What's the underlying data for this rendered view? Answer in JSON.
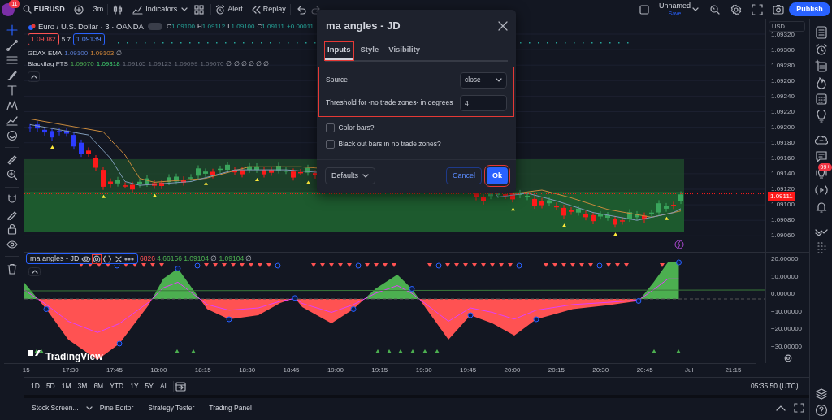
{
  "top_bar": {
    "notification_count": "11",
    "symbol": "EURUSD",
    "interval": "3m",
    "indicators": "Indicators",
    "alert": "Alert",
    "replay": "Replay",
    "layout_name": "Unnamed",
    "save": "Save",
    "publish": "Publish"
  },
  "chart": {
    "title": "Euro / U.S. Dollar · 3 · OANDA",
    "ohlc": [
      {
        "label": "O",
        "value": "1.09100"
      },
      {
        "label": "H",
        "value": "1.09112"
      },
      {
        "label": "L",
        "value": "1.09100"
      },
      {
        "label": "C",
        "value": "1.09111"
      }
    ],
    "change": "+0.00011",
    "sell": "1.09082",
    "spread": "5.7",
    "buy": "1.09139",
    "studies": [
      {
        "name": "GDAX EMA",
        "values": [
          {
            "text": "1.09100",
            "kind": "blue"
          },
          {
            "text": "1.09103",
            "kind": "orange"
          },
          {
            "text": "∅",
            "kind": "empty"
          }
        ]
      },
      {
        "name": "Blackflag FTS",
        "values": [
          {
            "text": "1.09070",
            "kind": "green"
          },
          {
            "text": "1.09318",
            "kind": "bright"
          },
          {
            "text": "1.09165",
            "kind": "faded"
          },
          {
            "text": "1.09123",
            "kind": "faded"
          },
          {
            "text": "1.09099",
            "kind": "faded"
          },
          {
            "text": "1.09070",
            "kind": "faded"
          },
          {
            "text": "∅ ∅ ∅ ∅ ∅ ∅",
            "kind": "empty"
          }
        ]
      }
    ],
    "logo_text": "TradingView"
  },
  "price_axis": {
    "currency": "USD",
    "labels": [
      "1.09320",
      "1.09300",
      "1.09280",
      "1.09260",
      "1.09240",
      "1.09220",
      "1.09200",
      "1.09180",
      "1.09160",
      "1.09140",
      "1.09120",
      "1.09100",
      "1.09080",
      "1.09060"
    ],
    "last_price": "1.09111"
  },
  "oscillator": {
    "name": "ma angles - JD",
    "settings_highlighted": true,
    "values": [
      {
        "text": "6826",
        "kind": "red"
      },
      {
        "text": "4.66156",
        "kind": "green"
      },
      {
        "text": "1.09104",
        "kind": "green"
      },
      {
        "text": "∅",
        "kind": "empty"
      },
      {
        "text": "1.09104",
        "kind": "green"
      },
      {
        "text": "∅",
        "kind": "empty"
      }
    ],
    "axis_labels": [
      "20.00000",
      "10.00000",
      "0.00000",
      "−10.00000",
      "−20.00000",
      "−30.00000"
    ]
  },
  "time_axis": [
    "15",
    "17:30",
    "17:45",
    "18:00",
    "18:15",
    "18:30",
    "18:45",
    "19:00",
    "19:15",
    "19:30",
    "19:45",
    "20:00",
    "20:15",
    "20:30",
    "20:45",
    "Jul",
    "21:15"
  ],
  "ranges": [
    "1D",
    "5D",
    "1M",
    "3M",
    "6M",
    "YTD",
    "1Y",
    "5Y",
    "All"
  ],
  "clock": "05:35:50 (UTC)",
  "bottom_tabs": [
    "Stock Screen...",
    "Pine Editor",
    "Strategy Tester",
    "Trading Panel"
  ],
  "alerts_badge": "99+",
  "dialog": {
    "title": "ma angles - JD",
    "tabs": [
      {
        "label": "Inputs",
        "selected": true,
        "highlighted": true
      },
      {
        "label": "Style",
        "selected": false,
        "highlighted": false
      },
      {
        "label": "Visibility",
        "selected": false,
        "highlighted": false
      }
    ],
    "inputs_highlighted": true,
    "fields": [
      {
        "kind": "select",
        "label": "Source",
        "value": "close"
      },
      {
        "kind": "number",
        "label": "Threshold for -no trade zones- in degrees",
        "value": "4"
      }
    ],
    "checkboxes": [
      {
        "label": "Color bars?",
        "checked": false
      },
      {
        "label": "Black out bars in no trade zones?",
        "checked": false
      }
    ],
    "defaults": "Defaults",
    "buttons": [
      {
        "kind": "cancel",
        "label": "Cancel",
        "highlighted": false
      },
      {
        "kind": "ok",
        "label": "Ok",
        "highlighted": true
      }
    ]
  }
}
